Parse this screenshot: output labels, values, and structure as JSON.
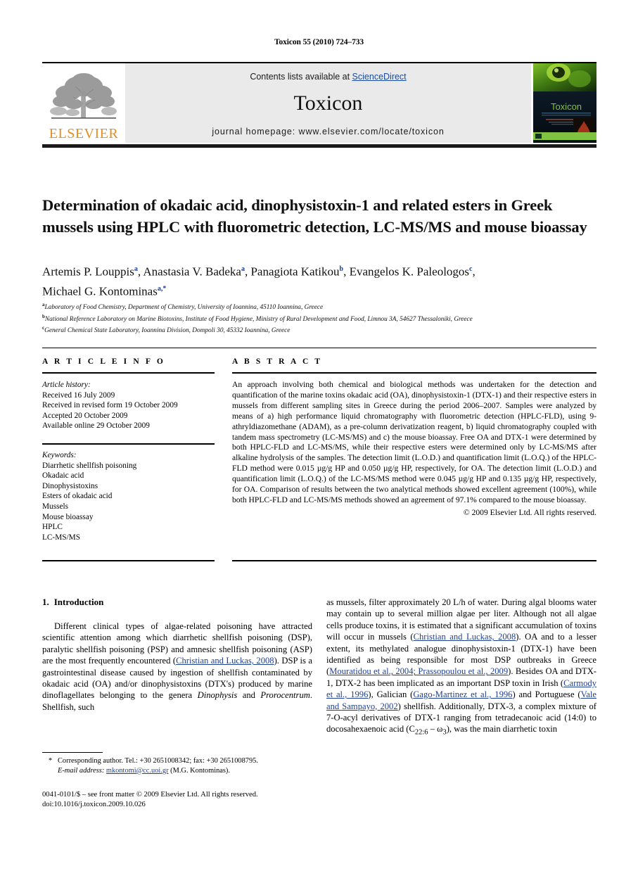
{
  "running_head": "Toxicon 55 (2010) 724–733",
  "masthead": {
    "contents_prefix": "Contents lists available at ",
    "sciencedirect": "ScienceDirect",
    "journal_title": "Toxicon",
    "homepage": "journal homepage: www.elsevier.com/locate/toxicon",
    "publisher": "ELSEVIER",
    "cover_title": "Toxicon",
    "accent_orange": "#E88C1E",
    "link_blue": "#1a4b9c",
    "panel_grey": "#eaeaea"
  },
  "article": {
    "title": "Determination of okadaic acid, dinophysistoxin-1 and related esters in Greek mussels using HPLC with fluorometric detection, LC-MS/MS and mouse bioassay",
    "authors_line1_a": "Artemis P. Louppis",
    "authors_sup1": "a",
    "authors_line1_b": ", Anastasia V. Badeka",
    "authors_sup2": "a",
    "authors_line1_c": ", Panagiota Katikou",
    "authors_sup3": "b",
    "authors_line1_d": ", Evangelos K. Paleologos",
    "authors_sup4": "c",
    "authors_line1_e": ",",
    "authors_line2": "Michael G. Kontominas",
    "authors_sup5": "a,*",
    "affiliations": [
      {
        "marker": "a",
        "text": "Laboratory of Food Chemistry, Department of Chemistry, University of Ioannina, 45110 Ioannina, Greece"
      },
      {
        "marker": "b",
        "text": "National Reference Laboratory on Marine Biotoxins, Institute of Food Hygiene, Ministry of Rural Development and Food, Limnou 3A, 54627 Thessaloniki, Greece"
      },
      {
        "marker": "c",
        "text": "General Chemical State Laboratory, Ioannina Division, Dompoli 30, 45332 Ioannina, Greece"
      }
    ]
  },
  "info": {
    "heading": "A R T I C L E    I N F O",
    "history_label": "Article history:",
    "history": [
      "Received 16 July 2009",
      "Received in revised form 19 October 2009",
      "Accepted 20 October 2009",
      "Available online 29 October 2009"
    ],
    "keywords_label": "Keywords:",
    "keywords": [
      "Diarrhetic shellfish poisoning",
      "Okadaic acid",
      "Dinophysistoxins",
      "Esters of okadaic acid",
      "Mussels",
      "Mouse bioassay",
      "HPLC",
      "LC-MS/MS"
    ]
  },
  "abstract": {
    "heading": "A B S T R A C T",
    "text": "An approach involving both chemical and biological methods was undertaken for the detection and quantification of the marine toxins okadaic acid (OA), dinophysistoxin-1 (DTX-1) and their respective esters in mussels from different sampling sites in Greece during the period 2006–2007. Samples were analyzed by means of a) high performance liquid chromatography with fluorometric detection (HPLC-FLD), using 9-athryldiazomethane (ADAM), as a pre-column derivatization reagent, b) liquid chromatography coupled with tandem mass spectrometry (LC-MS/MS) and c) the mouse bioassay. Free OA and DTX-1 were determined by both HPLC-FLD and LC-MS/MS, while their respective esters were determined only by LC-MS/MS after alkaline hydrolysis of the samples. The detection limit (L.O.D.) and quantification limit (L.O.Q.) of the HPLC-FLD method were 0.015 µg/g HP and 0.050 µg/g HP, respectively, for OA. The detection limit (L.O.D.) and quantification limit (L.O.Q.) of the LC-MS/MS method were 0.045 µg/g HP and 0.135 µg/g HP, respectively, for OA. Comparison of results between the two analytical methods showed excellent agreement (100%), while both HPLC-FLD and LC-MS/MS methods showed an agreement of 97.1% compared to the mouse bioassay.",
    "copyright": "© 2009 Elsevier Ltd. All rights reserved."
  },
  "body": {
    "section_number": "1.",
    "section_title": "Introduction",
    "left_paragraph": {
      "p1": "Different clinical types of algae-related poisoning have attracted scientific attention among which diarrhetic shellfish poisoning (DSP), paralytic shellfish poisoning (PSP) and amnesic shellfish poisoning (ASP) are the most frequently encountered (",
      "ref1": "Christian and Luckas, 2008",
      "p2": "). DSP is a gastrointestinal disease caused by ingestion of shellfish contaminated by okadaic acid (OA) and/or dinophysistoxins (DTX's) produced by marine dinoflagellates belonging to the genera ",
      "genus1": "Dinophysis",
      "p3": " and ",
      "genus2": "Prorocentrum",
      "p4": ". Shellfish, such"
    },
    "right_paragraph": {
      "p1": "as mussels, filter approximately 20 L/h of water. During algal blooms water may contain up to several million algae per liter. Although not all algae cells produce toxins, it is estimated that a significant accumulation of toxins will occur in mussels (",
      "ref1": "Christian and Luckas, 2008",
      "p2": "). OA and to a lesser extent, its methylated analogue dinophysistoxin-1 (DTX-1) have been identified as being responsible for most DSP outbreaks in Greece (",
      "ref2": "Mouratidou et al., 2004; Prassopoulou et al., 2009",
      "p3": "). Besides OA and DTX-1, DTX-2 has been implicated as an important DSP toxin in Irish (",
      "ref3": "Carmody et al., 1996",
      "p4": "), Galician (",
      "ref4": "Gago-Martinez et al., 1996",
      "p5": ") and Portuguese (",
      "ref5": "Vale and Sampayo, 2002",
      "p6": ") shellfish. Additionally, DTX-3, a complex mixture of 7-O-acyl derivatives of DTX-1 ranging from tetradecanoic acid (14:0) to docosahexaenoic acid (C",
      "sub1": "22:6",
      "p7": " – ω",
      "sub2": "3",
      "p8": "), was the main diarrhetic toxin"
    }
  },
  "footnote": {
    "star": "*",
    "line1": "Corresponding author. Tel.: +30 2651008342; fax: +30 2651008795.",
    "email_label": "E-mail address:",
    "email": "mkontomi@cc.uoi.gr",
    "email_owner": "(M.G. Kontominas)."
  },
  "imprint": {
    "line1": "0041-0101/$ – see front matter © 2009 Elsevier Ltd. All rights reserved.",
    "line2": "doi:10.1016/j.toxicon.2009.10.026"
  }
}
